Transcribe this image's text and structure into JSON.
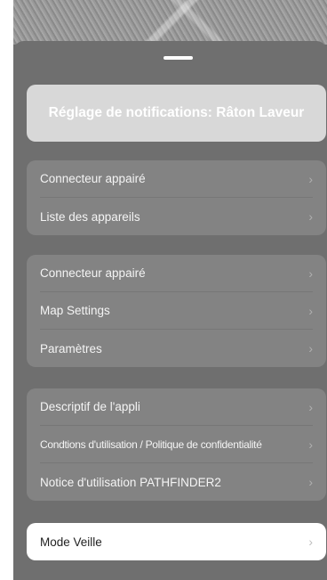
{
  "header": {
    "title": "Réglage de notifications: Râton Laveur"
  },
  "group1": {
    "items": [
      {
        "label": "Connecteur appairé"
      },
      {
        "label": "Liste des appareils"
      }
    ]
  },
  "group2": {
    "items": [
      {
        "label": "Connecteur appairé"
      },
      {
        "label": "Map Settings"
      },
      {
        "label": "Paramètres"
      }
    ]
  },
  "group3": {
    "items": [
      {
        "label": "Descriptif de l'appli"
      },
      {
        "label": "Condtions d'utilisation / Politique de confidentialité"
      },
      {
        "label": "Notice d'utilisation PATHFINDER2"
      }
    ]
  },
  "sleep": {
    "label": "Mode Veille"
  },
  "icons": {
    "chevron": "chevron-right-icon",
    "chevron_glyph": "›"
  },
  "colors": {
    "sheet": "#6f6f6f",
    "group": "#838383",
    "title_card": "#d8d8d8",
    "sleep_card": "#ffffff"
  }
}
